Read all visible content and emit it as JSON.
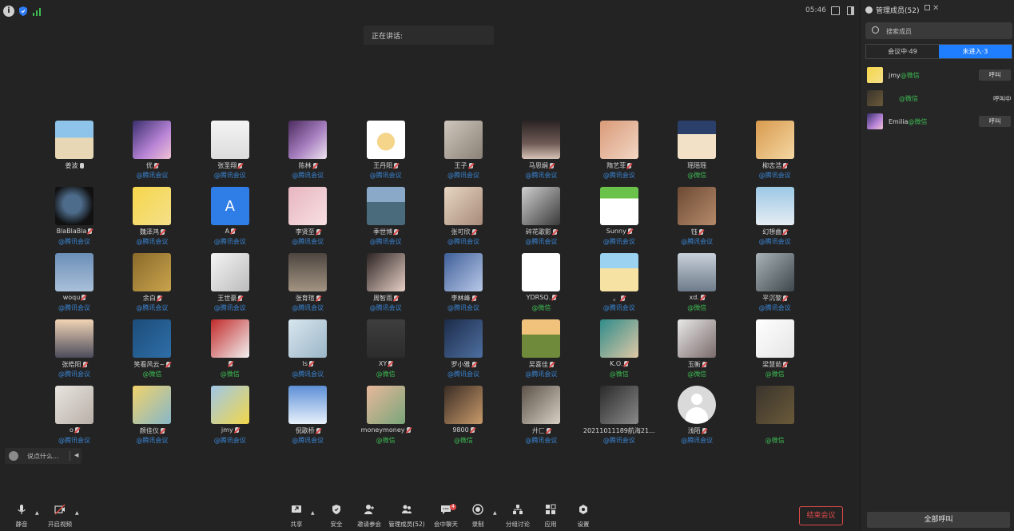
{
  "topbar": {
    "time": "05:46"
  },
  "speaking": {
    "label": "正在讲话:"
  },
  "participants": [
    {
      "name": "姜波",
      "platform": "",
      "mic": "on",
      "av": "beach"
    },
    {
      "name": "优",
      "platform": "@腾讯会议",
      "mic": "muted",
      "av": "anime-purple"
    },
    {
      "name": "张圣翔",
      "platform": "@腾讯会议",
      "mic": "muted",
      "av": "sketch"
    },
    {
      "name": "陈林",
      "platform": "@腾讯会议",
      "mic": "muted",
      "av": "anime-purple2"
    },
    {
      "name": "王丹阳",
      "platform": "@腾讯会议",
      "mic": "muted",
      "av": "duck"
    },
    {
      "name": "王子",
      "platform": "@腾讯会议",
      "mic": "muted",
      "av": "cat"
    },
    {
      "name": "马思娴",
      "platform": "@腾讯会议",
      "mic": "muted",
      "av": "girl-dark"
    },
    {
      "name": "隋艺菲",
      "platform": "@腾讯会议",
      "mic": "muted",
      "av": "girl-warm"
    },
    {
      "name": "瑶瑶瑶",
      "platform": "@微信",
      "mic": "none",
      "av": "shin"
    },
    {
      "name": "柳志浩",
      "platform": "@腾讯会议",
      "mic": "muted",
      "av": "dog"
    },
    {
      "name": "BlaBlaBla",
      "platform": "@腾讯会议",
      "mic": "muted",
      "av": "earth"
    },
    {
      "name": "魏泽鸿",
      "platform": "@腾讯会议",
      "mic": "muted",
      "av": "pikachu"
    },
    {
      "name": "A",
      "platform": "@腾讯会议",
      "mic": "muted",
      "av": "letter-A"
    },
    {
      "name": "李贤至",
      "platform": "@腾讯会议",
      "mic": "muted",
      "av": "girl-pink"
    },
    {
      "name": "季世博",
      "platform": "@腾讯会议",
      "mic": "muted",
      "av": "lake"
    },
    {
      "name": "张可欣",
      "platform": "@腾讯会议",
      "mic": "muted",
      "av": "anime-blonde"
    },
    {
      "name": "碎花歌影",
      "platform": "@腾讯会议",
      "mic": "muted",
      "av": "witch"
    },
    {
      "name": "Sunny",
      "platform": "@腾讯会议",
      "mic": "muted",
      "av": "kitty"
    },
    {
      "name": "钰",
      "platform": "@腾讯会议",
      "mic": "muted",
      "av": "bear"
    },
    {
      "name": "幻想曲",
      "platform": "@腾讯会议",
      "mic": "muted",
      "av": "girl-sea"
    },
    {
      "name": "woqu",
      "platform": "@腾讯会议",
      "mic": "muted",
      "av": "blue-man"
    },
    {
      "name": "余白",
      "platform": "@腾讯会议",
      "mic": "muted",
      "av": "autumn"
    },
    {
      "name": "王世豪",
      "platform": "@腾讯会议",
      "mic": "muted",
      "av": "luffy"
    },
    {
      "name": "张育瑄",
      "platform": "@腾讯会议",
      "mic": "muted",
      "av": "sunset"
    },
    {
      "name": "周智雨",
      "platform": "@腾讯会议",
      "mic": "muted",
      "av": "girl-hair"
    },
    {
      "name": "李林峰",
      "platform": "@腾讯会议",
      "mic": "muted",
      "av": "whale"
    },
    {
      "name": "YDRSQ.",
      "platform": "@微信",
      "mic": "muted",
      "av": "doodle"
    },
    {
      "name": "。",
      "platform": "@腾讯会议",
      "mic": "muted",
      "av": "cartoon-hat"
    },
    {
      "name": "xd.",
      "platform": "@微信",
      "mic": "muted",
      "av": "snow"
    },
    {
      "name": "平沉黎",
      "platform": "@腾讯会议",
      "mic": "muted",
      "av": "man-bw"
    },
    {
      "name": "张皓阳",
      "platform": "@腾讯会议",
      "mic": "muted",
      "av": "city"
    },
    {
      "name": "笑看风云~",
      "platform": "@微信",
      "mic": "muted",
      "av": "blue-anime"
    },
    {
      "name": "",
      "platform": "@微信",
      "mic": "muted",
      "av": "red-anime"
    },
    {
      "name": "ls",
      "platform": "@腾讯会议",
      "mic": "muted",
      "av": "white-anime"
    },
    {
      "name": "XY",
      "platform": "@微信",
      "mic": "muted",
      "av": "dark-gray"
    },
    {
      "name": "罗小雅",
      "platform": "@腾讯会议",
      "mic": "muted",
      "av": "boy-blue"
    },
    {
      "name": "吴喜佳",
      "platform": "@腾讯会议",
      "mic": "muted",
      "av": "field"
    },
    {
      "name": "K.O.",
      "platform": "@微信",
      "mic": "muted",
      "av": "teal-anime"
    },
    {
      "name": "玉衡",
      "platform": "@微信",
      "mic": "muted",
      "av": "silver-anime"
    },
    {
      "name": "梁慧茹",
      "platform": "@微信",
      "mic": "muted",
      "av": "manga"
    },
    {
      "name": "o",
      "platform": "@腾讯会议",
      "mic": "muted",
      "av": "cat-white"
    },
    {
      "name": "颜佳仪",
      "platform": "@腾讯会议",
      "mic": "muted",
      "av": "blonde-boy"
    },
    {
      "name": "jmy",
      "platform": "@腾讯会议",
      "mic": "muted",
      "av": "sponge"
    },
    {
      "name": "倪歌桥",
      "platform": "@腾讯会议",
      "mic": "muted",
      "av": "sky"
    },
    {
      "name": "moneymoney",
      "platform": "@微信",
      "mic": "muted",
      "av": "money"
    },
    {
      "name": "9800",
      "platform": "@微信",
      "mic": "muted",
      "av": "dog-brown"
    },
    {
      "name": "廾匚",
      "platform": "@腾讯会议",
      "mic": "muted",
      "av": "man-curl"
    },
    {
      "name": "20211011189航海21...",
      "platform": "@腾讯会议",
      "mic": "none",
      "av": "man-dark"
    },
    {
      "name": "浅陌",
      "platform": "@腾讯会议",
      "mic": "muted",
      "av": "default"
    },
    {
      "name": "",
      "platform": "@微信",
      "mic": "none",
      "av": "dim"
    }
  ],
  "chat": {
    "placeholder": "说点什么..."
  },
  "toolbar": {
    "mute": "静音",
    "video": "开启视频",
    "share": "共享",
    "security": "安全",
    "invite": "邀请参会",
    "members": "管理成员(52)",
    "chat": "会中聊天",
    "chat_badge": "4",
    "record": "录制",
    "breakout": "分组讨论",
    "apps": "应用",
    "settings": "设置",
    "end": "结束会议"
  },
  "panel": {
    "title": "管理成员(52)",
    "search_placeholder": "搜索成员",
    "tab_in": "会议中·49",
    "tab_out": "未进入·3",
    "rows": [
      {
        "name": "jmy",
        "platform": "@微信",
        "action": "呼叫",
        "av": "pikachu"
      },
      {
        "name": "",
        "platform": "@微信",
        "action": "呼叫中",
        "av": "dim"
      },
      {
        "name": "Emilia",
        "platform": "@微信",
        "action": "呼叫",
        "av": "anime-purple"
      }
    ],
    "call_all": "全部呼叫"
  },
  "colors": {
    "accent": "#1f7dff",
    "end": "#e04a4a",
    "wechat": "#3dbb52",
    "tencent": "#3a86d6"
  }
}
